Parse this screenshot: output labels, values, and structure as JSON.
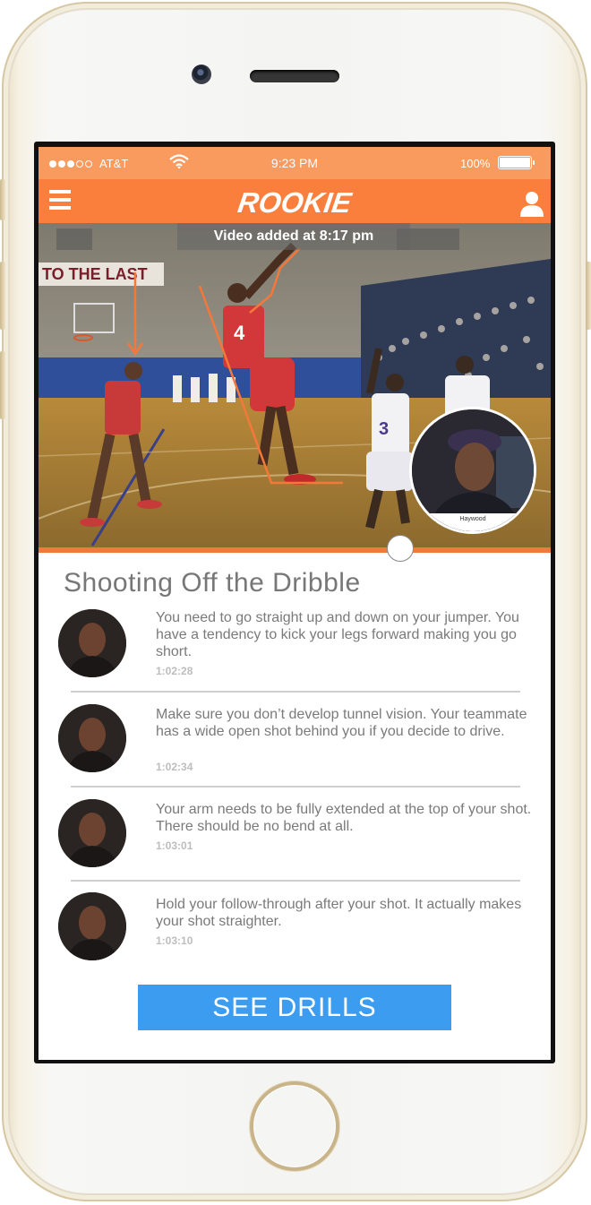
{
  "status_bar": {
    "carrier": "AT&T",
    "time": "9:23 PM",
    "battery": "100%",
    "signal_bars_filled": 3,
    "signal_bars_total": 5
  },
  "nav": {
    "app_title": "ROOKIE",
    "menu_icon": "hamburger-menu-icon",
    "profile_icon": "user-profile-icon"
  },
  "video": {
    "banner": "Video added at 8:17 pm",
    "coach_name": "Haywood",
    "progress_fraction": 0.7
  },
  "drill": {
    "title": "Shooting Off the Dribble"
  },
  "comments": [
    {
      "text": "You need to go straight up and down on your jumper. You have a tendency to kick your legs forward making you go short.",
      "time": "1:02:28"
    },
    {
      "text": "Make sure you don’t develop tunnel vision. Your teammate has a wide open shot behind you if you decide to drive.",
      "time": "1:02:34"
    },
    {
      "text": "Your arm needs to be fully extended at the top of your shot. There should be no bend at all.",
      "time": "1:03:01"
    },
    {
      "text": "Hold your follow-through after your shot. It actually makes your shot straighter.",
      "time": "1:03:10"
    }
  ],
  "actions": {
    "see_drills": "SEE DRILLS"
  },
  "colors": {
    "status_bar": "#f99a5e",
    "nav_bar": "#fb7f3c",
    "button": "#3b9cf0",
    "annotation": "#f5783a"
  }
}
